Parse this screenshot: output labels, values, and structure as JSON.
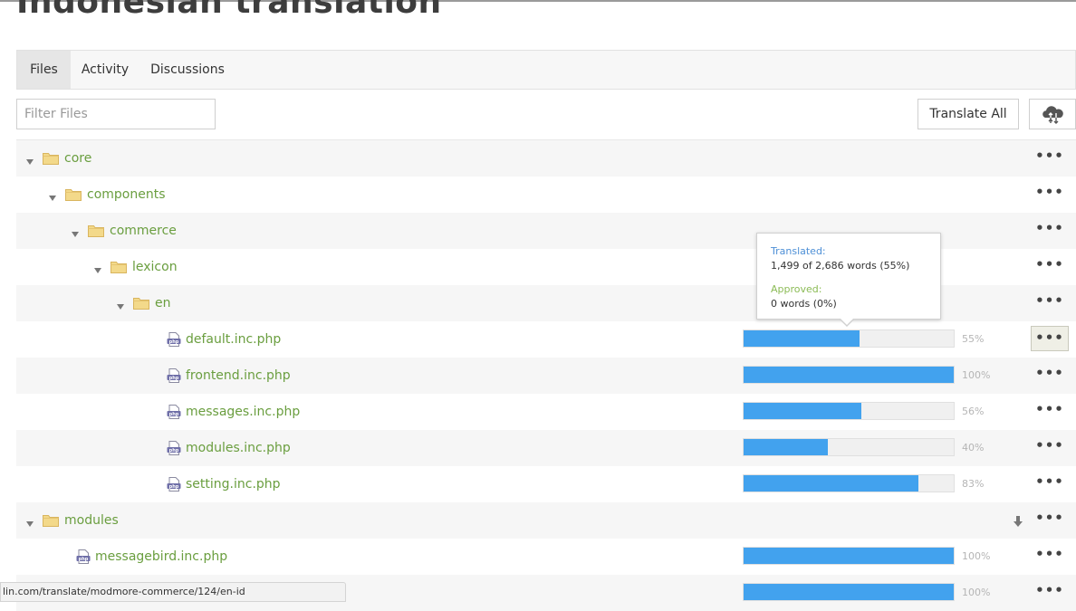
{
  "page": {
    "title": "Indonesian translation"
  },
  "tabs": [
    {
      "label": "Files",
      "active": true
    },
    {
      "label": "Activity",
      "active": false
    },
    {
      "label": "Discussions",
      "active": false
    }
  ],
  "toolbar": {
    "filter_placeholder": "Filter Files",
    "translate_all_label": "Translate All",
    "upload_icon": "cloud-upload-download-icon"
  },
  "tree": [
    {
      "type": "folder",
      "name": "core",
      "depth": 0,
      "expanded": true
    },
    {
      "type": "folder",
      "name": "components",
      "depth": 1,
      "expanded": true
    },
    {
      "type": "folder",
      "name": "commerce",
      "depth": 2,
      "expanded": true
    },
    {
      "type": "folder",
      "name": "lexicon",
      "depth": 3,
      "expanded": true
    },
    {
      "type": "folder",
      "name": "en",
      "depth": 4,
      "expanded": true
    },
    {
      "type": "file",
      "name": "default.inc.php",
      "depth": 5,
      "progress": 55,
      "progress_label": "55%",
      "hover": true
    },
    {
      "type": "file",
      "name": "frontend.inc.php",
      "depth": 5,
      "progress": 100,
      "progress_label": "100%"
    },
    {
      "type": "file",
      "name": "messages.inc.php",
      "depth": 5,
      "progress": 56,
      "progress_label": "56%"
    },
    {
      "type": "file",
      "name": "modules.inc.php",
      "depth": 5,
      "progress": 40,
      "progress_label": "40%"
    },
    {
      "type": "file",
      "name": "setting.inc.php",
      "depth": 5,
      "progress": 83,
      "progress_label": "83%"
    },
    {
      "type": "folder",
      "name": "modules",
      "depth": 0,
      "expanded": true,
      "download": true
    },
    {
      "type": "file",
      "name": "messagebird.inc.php",
      "depth": 1,
      "progress": 100,
      "progress_label": "100%"
    },
    {
      "type": "file",
      "name": "",
      "depth": 1,
      "progress": 100,
      "progress_label": "100%"
    }
  ],
  "tooltip": {
    "translated_label": "Translated:",
    "translated_value": "1,499 of 2,686 words (55%)",
    "approved_label": "Approved:",
    "approved_value": "0 words (0%)"
  },
  "menu_dots": "•••",
  "status_url": "lin.com/translate/modmore-commerce/124/en-id",
  "colors": {
    "progress": "#42a2ee",
    "link": "#6a9e3f",
    "folder": "#f3d98a",
    "translated": "#4d8fd6",
    "approved": "#8bbb55"
  }
}
